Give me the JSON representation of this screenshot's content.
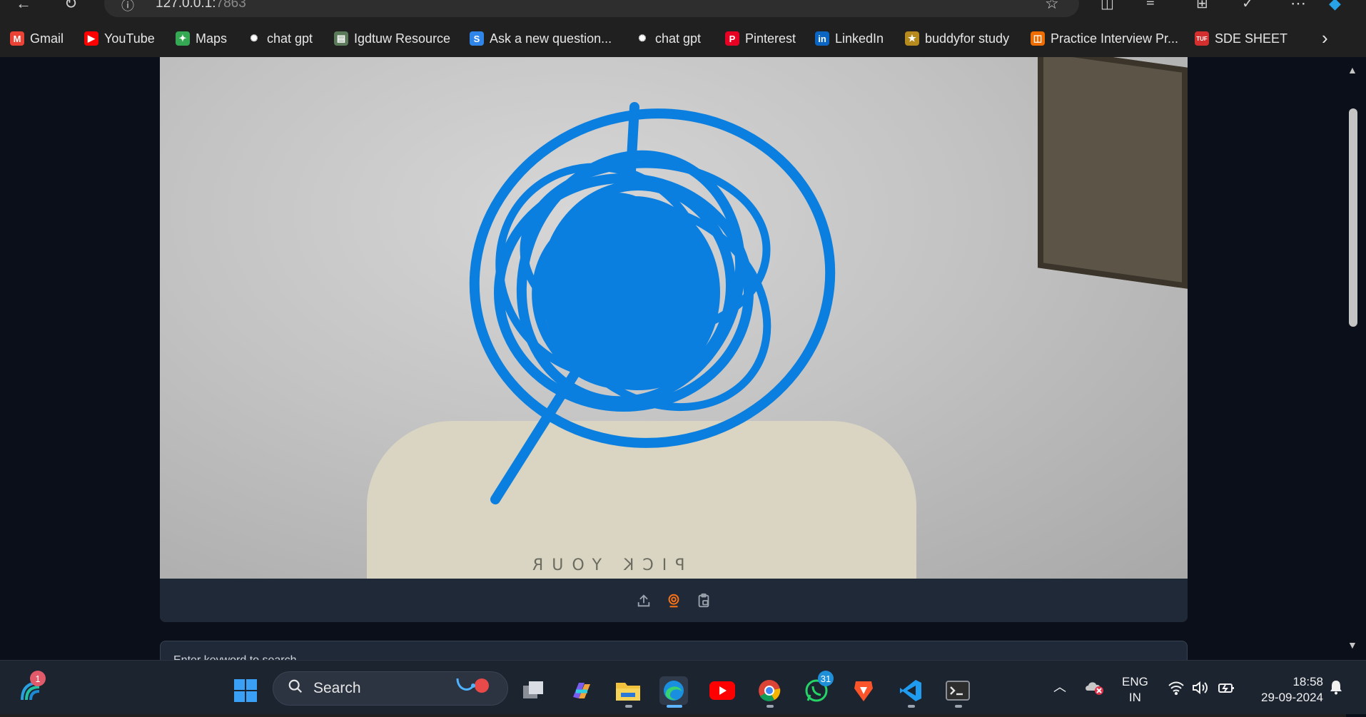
{
  "browser": {
    "url_host": "127.0.0.1:",
    "url_port": "7863"
  },
  "bookmarks": [
    {
      "label": "Gmail",
      "icon": "gmail-icon",
      "color": "#ea4335",
      "glyph": "M"
    },
    {
      "label": "YouTube",
      "icon": "youtube-icon",
      "color": "#ff0000",
      "glyph": "▶"
    },
    {
      "label": "Maps",
      "icon": "maps-icon",
      "color": "#34a853",
      "glyph": "✦"
    },
    {
      "label": "chat gpt",
      "icon": "chatgpt-icon",
      "color": "#202020",
      "glyph": "✺"
    },
    {
      "label": "Igdtuw Resource",
      "icon": "resource-icon",
      "color": "#5a7a5a",
      "glyph": "▤"
    },
    {
      "label": "Ask a new question...",
      "icon": "ask-icon",
      "color": "#2f86e8",
      "glyph": "S"
    },
    {
      "label": "chat gpt",
      "icon": "chatgpt-icon",
      "color": "#202020",
      "glyph": "✺"
    },
    {
      "label": "Pinterest",
      "icon": "pinterest-icon",
      "color": "#e60023",
      "glyph": "P"
    },
    {
      "label": "LinkedIn",
      "icon": "linkedin-icon",
      "color": "#0a66c2",
      "glyph": "in"
    },
    {
      "label": "buddyfor study",
      "icon": "buddy-icon",
      "color": "#b78a1e",
      "glyph": "★"
    },
    {
      "label": "Practice Interview Pr...",
      "icon": "practice-icon",
      "color": "#ef6c00",
      "glyph": "◫"
    },
    {
      "label": "SDE SHEET",
      "icon": "tuf-icon",
      "color": "#d32f2f",
      "glyph": "TUF"
    }
  ],
  "webcam": {
    "shirt_text": "PICK YOUR"
  },
  "search_section": {
    "label": "Enter keyword to search"
  },
  "taskbar": {
    "search_placeholder": "Search",
    "weather_badge": "1",
    "whatsapp_badge": "31",
    "language": "ENG",
    "region": "IN",
    "time": "18:58",
    "date": "29-09-2024"
  },
  "colors": {
    "accent": "#f97316",
    "scribble": "#0a7fe0",
    "page_bg": "#0b0f19",
    "card_bg": "#1f2937"
  }
}
